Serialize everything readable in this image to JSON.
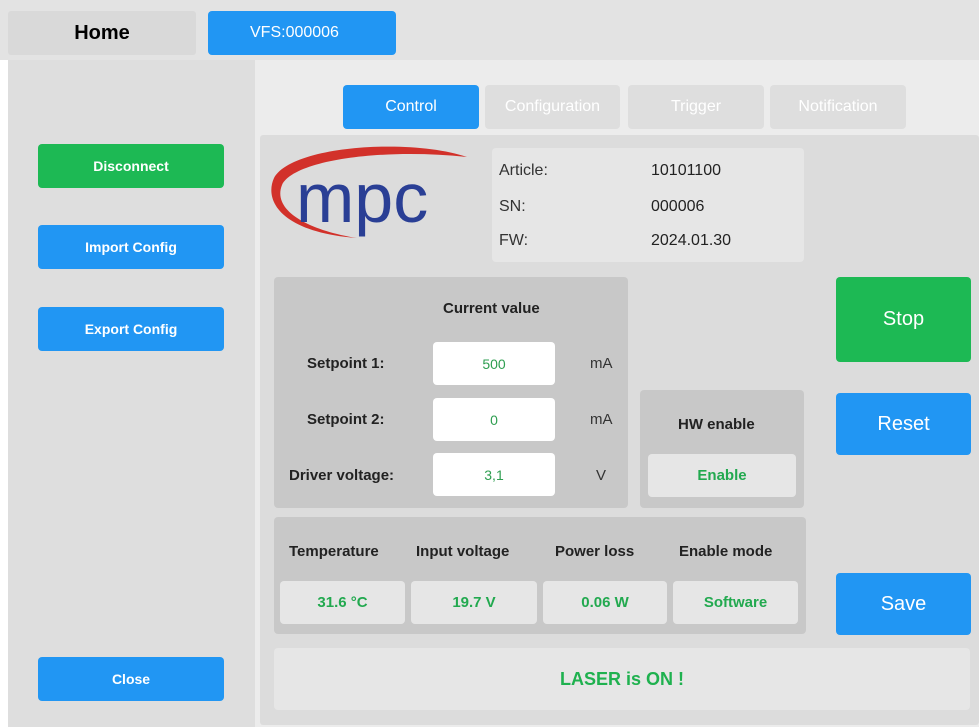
{
  "window": {
    "home_tab": "Home",
    "device_tab": "VFS:000006"
  },
  "sidebar": {
    "disconnect": "Disconnect",
    "import_config": "Import Config",
    "export_config": "Export Config",
    "close": "Close"
  },
  "tabs": [
    "Control",
    "Configuration",
    "Trigger",
    "Notification"
  ],
  "logo": {
    "text": "mpc"
  },
  "device_info": {
    "article_label": "Article:",
    "article_value": "10101100",
    "sn_label": "SN:",
    "sn_value": "000006",
    "fw_label": "FW:",
    "fw_value": "2024.01.30"
  },
  "current_value": {
    "header": "Current value",
    "setpoint1_label": "Setpoint 1:",
    "setpoint1_value": "500",
    "setpoint1_unit": "mA",
    "setpoint2_label": "Setpoint 2:",
    "setpoint2_value": "0",
    "setpoint2_unit": "mA",
    "driver_voltage_label": "Driver voltage:",
    "driver_voltage_value": "3,1",
    "driver_voltage_unit": "V"
  },
  "hw_enable": {
    "label": "HW enable",
    "value": "Enable"
  },
  "status_table": {
    "headers": [
      "Temperature",
      "Input voltage",
      "Power loss",
      "Enable mode"
    ],
    "values": [
      "31.6 °C",
      "19.7 V",
      "0.06 W",
      "Software"
    ]
  },
  "actions": {
    "stop": "Stop",
    "reset": "Reset",
    "save": "Save"
  },
  "status_message": "LASER is ON !",
  "colors": {
    "accent_blue": "#2196f3",
    "accent_green": "#1db954",
    "status_green": "#22a94f",
    "logo_blue": "#2a3f95",
    "logo_red": "#d2312a"
  }
}
